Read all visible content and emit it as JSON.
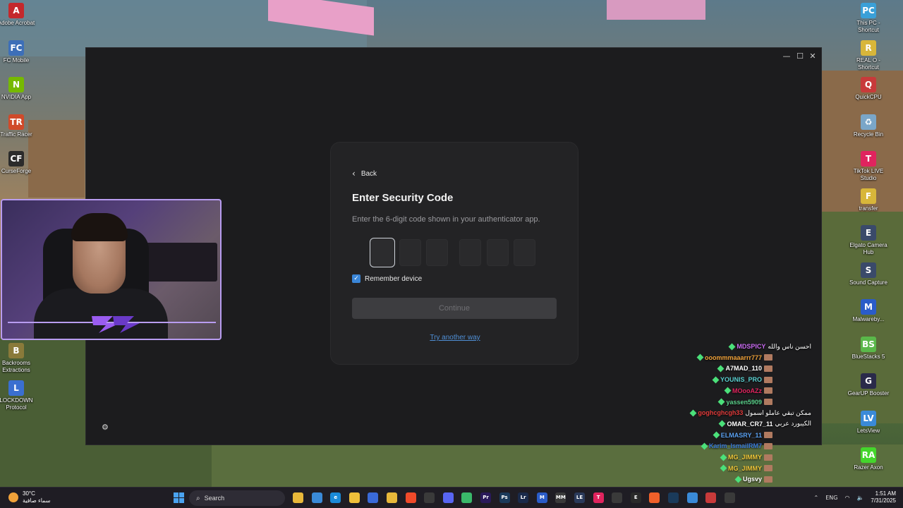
{
  "desktop": {
    "left_icons": [
      {
        "label": "Adobe Acrobat",
        "color": "#c4282c",
        "glyph": "A"
      },
      {
        "label": "FC Mobile",
        "color": "#3d6fb8",
        "glyph": "FC"
      },
      {
        "label": "NVIDIA App",
        "color": "#76b900",
        "glyph": "N"
      },
      {
        "label": "Traffic Racer",
        "color": "#d04a2a",
        "glyph": "TR"
      },
      {
        "label": "CurseForge",
        "color": "#2b2b2b",
        "glyph": "CF"
      },
      {
        "label": "Backrooms Extractions",
        "color": "#8a7a3a",
        "glyph": "B"
      },
      {
        "label": "LOCKDOWN Protocol",
        "color": "#3a6fd0",
        "glyph": "L"
      }
    ],
    "right_icons": [
      {
        "label": "This PC - Shortcut",
        "color": "#3aa0d8",
        "glyph": "PC"
      },
      {
        "label": "REAL O - Shortcut",
        "color": "#d8b63a",
        "glyph": "R"
      },
      {
        "label": "QuickCPU",
        "color": "#c83a3a",
        "glyph": "Q"
      },
      {
        "label": "Recycle Bin",
        "color": "#7aa6c8",
        "glyph": "♻"
      },
      {
        "label": "TikTok LIVE Studio",
        "color": "#e0245e",
        "glyph": "T"
      },
      {
        "label": "transfer",
        "color": "#d8b63a",
        "glyph": "F"
      },
      {
        "label": "Elgato Camera Hub",
        "color": "#3a4a6a",
        "glyph": "E"
      },
      {
        "label": "Sound Capture",
        "color": "#3a4a6a",
        "glyph": "S"
      },
      {
        "label": "Malwareby...",
        "color": "#2a5cc8",
        "glyph": "M"
      },
      {
        "label": "BlueStacks 5",
        "color": "#5ab84a",
        "glyph": "BS"
      },
      {
        "label": "GearUP Booster",
        "color": "#2a2a4a",
        "glyph": "G"
      },
      {
        "label": "LetsView",
        "color": "#3a8ad8",
        "glyph": "LV"
      },
      {
        "label": "Razer Axon",
        "color": "#44d62c",
        "glyph": "RA"
      }
    ]
  },
  "window": {
    "controls": {
      "minimize": "—",
      "maximize": "☐",
      "close": "✕"
    },
    "settings_icon": "⚙",
    "card": {
      "back_icon": "‹",
      "back_label": "Back",
      "title": "Enter Security Code",
      "subtitle": "Enter the 6-digit code shown in your authenticator app.",
      "code_length": 6,
      "remember_checked": true,
      "remember_label": "Remember device",
      "continue_label": "Continue",
      "try_another": "Try another way"
    }
  },
  "chat": [
    {
      "user": "MDSPICY",
      "color": "#c86af0",
      "msg": "احسن ناس والله",
      "emote": false
    },
    {
      "user": "ooommmaaarrr777",
      "color": "#f0a23a",
      "msg": "",
      "emote": true
    },
    {
      "user": "A7MAD_110",
      "color": "#ffffff",
      "msg": "",
      "emote": true
    },
    {
      "user": "YOUNIS_PRO",
      "color": "#5ad0d0",
      "msg": "",
      "emote": true
    },
    {
      "user": "MOooAZz",
      "color": "#e0245e",
      "msg": "",
      "emote": true
    },
    {
      "user": "yassen5909",
      "color": "#5ad08a",
      "msg": "",
      "emote": true
    },
    {
      "user": "goghcghcgh33",
      "color": "#e03a3a",
      "msg": "ممكن تبقي عاملو اسمول",
      "emote": false
    },
    {
      "user": "OMAR_CR7_11",
      "color": "#ffffff",
      "msg": "الكيبورد عربي",
      "emote": false
    },
    {
      "user": "ELMASRY_11",
      "color": "#5aa0f0",
      "msg": "",
      "emote": true
    },
    {
      "user": "Karim_IsmailRM7",
      "color": "#3a7ad8",
      "msg": "",
      "emote": true
    },
    {
      "user": "MG_JIMMY",
      "color": "#f0c83a",
      "msg": "",
      "emote": true
    },
    {
      "user": "MG_JIMMY",
      "color": "#f0c83a",
      "msg": "",
      "emote": true
    },
    {
      "user": "Ugsvy",
      "color": "#ffffff",
      "msg": "",
      "emote": true
    },
    {
      "user": "MG_JIMMY",
      "color": "#f0c83a",
      "msg": "",
      "emote": true
    }
  ],
  "taskbar": {
    "weather_temp": "30°C",
    "weather_desc": "سماء صافية",
    "search_label": "Search",
    "language": "ENG",
    "time": "1:51 AM",
    "date": "7/31/2025",
    "apps": [
      {
        "name": "file-explorer",
        "color": "#e8b83a",
        "glyph": ""
      },
      {
        "name": "copilot",
        "color": "#3a8ad8",
        "glyph": ""
      },
      {
        "name": "edge",
        "color": "#1a8ad8",
        "glyph": "e"
      },
      {
        "name": "folder",
        "color": "#f0c03a",
        "glyph": ""
      },
      {
        "name": "store",
        "color": "#3a6ad8",
        "glyph": ""
      },
      {
        "name": "chrome",
        "color": "#e8b83a",
        "glyph": ""
      },
      {
        "name": "brave",
        "color": "#f04a2a",
        "glyph": ""
      },
      {
        "name": "obs",
        "color": "#3a3a3a",
        "glyph": ""
      },
      {
        "name": "discord",
        "color": "#5865f2",
        "glyph": ""
      },
      {
        "name": "app-green",
        "color": "#3ab86a",
        "glyph": ""
      },
      {
        "name": "premiere",
        "color": "#2a1a5a",
        "glyph": "Pr"
      },
      {
        "name": "photoshop",
        "color": "#1a3a5a",
        "glyph": "Ps"
      },
      {
        "name": "lightroom",
        "color": "#1a2a4a",
        "glyph": "Lr"
      },
      {
        "name": "malwarebytes",
        "color": "#2a5cc8",
        "glyph": "M"
      },
      {
        "name": "mm",
        "color": "#3a3a3a",
        "glyph": "MM"
      },
      {
        "name": "le",
        "color": "#2a3a5a",
        "glyph": "LE"
      },
      {
        "name": "tiktok",
        "color": "#e0245e",
        "glyph": "T"
      },
      {
        "name": "app-round",
        "color": "#3a3a3a",
        "glyph": ""
      },
      {
        "name": "epic",
        "color": "#2a2a2a",
        "glyph": "E"
      },
      {
        "name": "app-orange",
        "color": "#f0602a",
        "glyph": ""
      },
      {
        "name": "steam",
        "color": "#1a3a5a",
        "glyph": ""
      },
      {
        "name": "app-blue",
        "color": "#3a8ad8",
        "glyph": ""
      },
      {
        "name": "app-red",
        "color": "#c83a3a",
        "glyph": ""
      },
      {
        "name": "app-dark",
        "color": "#3a3a3a",
        "glyph": ""
      }
    ]
  }
}
